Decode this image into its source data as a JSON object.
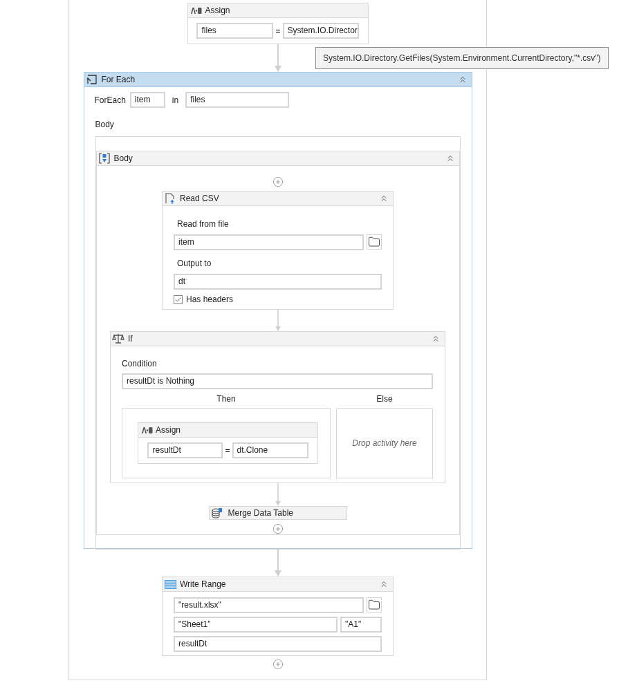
{
  "assign": {
    "title": "Assign",
    "to": "files",
    "operator": "=",
    "value": "System.IO.Director"
  },
  "tooltip": "System.IO.Directory.GetFiles(System.Environment.CurrentDirectory,\"*.csv\")",
  "for_each": {
    "title": "For Each",
    "selected": true,
    "foreach_label": "ForEach",
    "item": "item",
    "in_label": "in",
    "values": "files",
    "body_label": "Body",
    "body": {
      "title": "Body",
      "read_csv": {
        "title": "Read CSV",
        "file_label": "Read from file",
        "file": "item",
        "output_label": "Output to",
        "output": "dt",
        "has_headers": {
          "label": "Has headers",
          "checked": true
        }
      },
      "if": {
        "title": "If",
        "condition_label": "Condition",
        "condition": "resultDt is Nothing",
        "then_label": "Then",
        "else_label": "Else",
        "then": {
          "title": "Assign",
          "to": "resultDt",
          "operator": "=",
          "value": "dt.Clone"
        },
        "else_placeholder": "Drop activity here"
      },
      "merge": {
        "title": "Merge Data Table"
      }
    }
  },
  "write_range": {
    "title": "Write Range",
    "workbook": "\"result.xlsx\"",
    "sheet": "\"Sheet1\"",
    "start_cell": "\"A1\"",
    "datatable": "resultDt"
  }
}
